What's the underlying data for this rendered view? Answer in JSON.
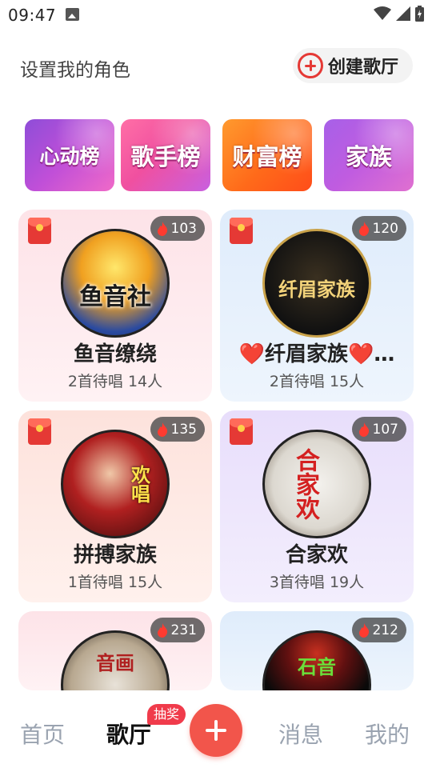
{
  "status_bar": {
    "time": "09:47"
  },
  "header": {
    "title": "设置我的角色",
    "create_button": "创建歌厅"
  },
  "banners": [
    {
      "label": "心动榜"
    },
    {
      "label": "歌手榜"
    },
    {
      "label": "财富榜"
    },
    {
      "label": "家族"
    }
  ],
  "rooms": [
    {
      "name": "鱼音缭绕",
      "meta": "2首待唱 14人",
      "heat": "103",
      "avatar_text": "鱼音社"
    },
    {
      "name": "❤️纤眉家族❤️…",
      "meta": "2首待唱 15人",
      "heat": "120",
      "avatar_text": "纤眉家族"
    },
    {
      "name": "拼搏家族",
      "meta": "1首待唱 15人",
      "heat": "135",
      "avatar_text": "欢唱"
    },
    {
      "name": "合家欢",
      "meta": "3首待唱 19人",
      "heat": "107",
      "avatar_text": "合家欢"
    },
    {
      "name": "",
      "meta": "",
      "heat": "231",
      "avatar_text": "音画"
    },
    {
      "name": "",
      "meta": "",
      "heat": "212",
      "avatar_text": "石音"
    }
  ],
  "bottom_nav": {
    "home": "首页",
    "ktv": "歌厅",
    "lottery_badge": "抽奖",
    "messages": "消息",
    "mine": "我的"
  }
}
